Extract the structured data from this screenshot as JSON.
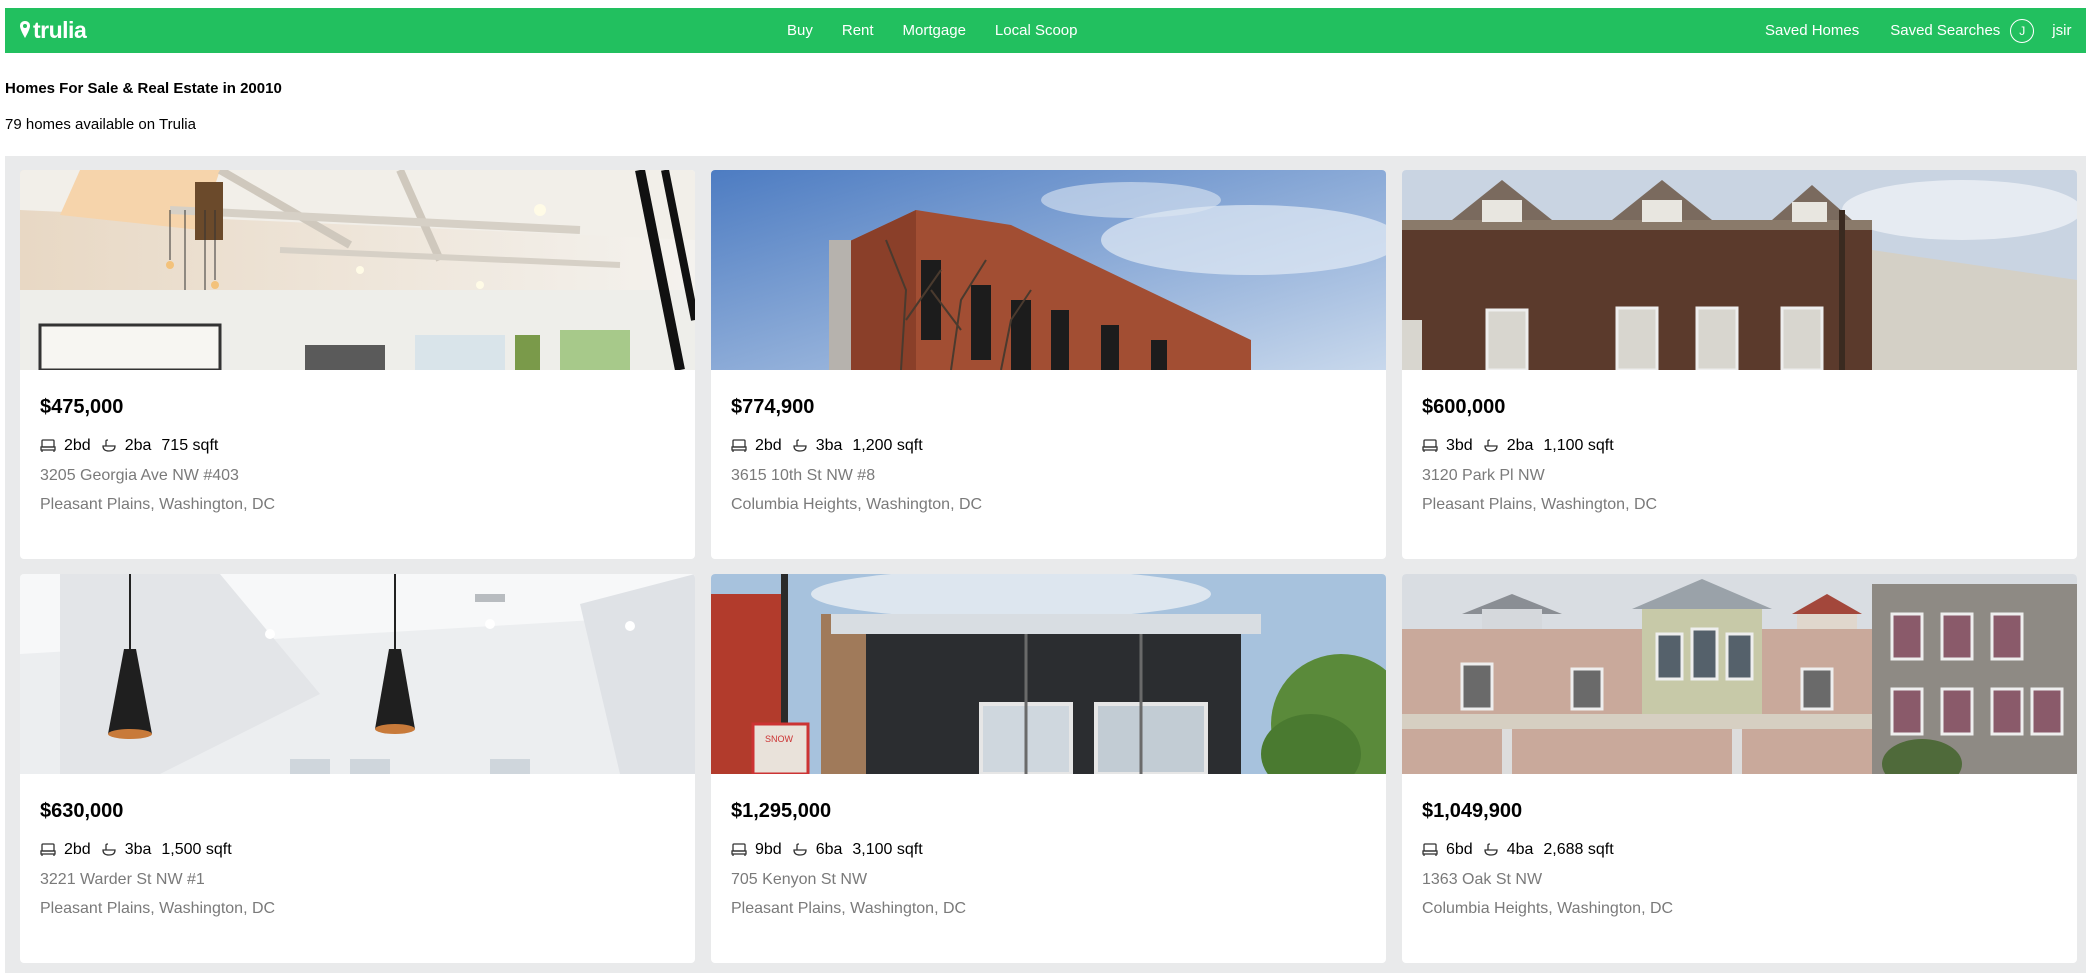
{
  "header": {
    "logo_text": "trulia",
    "nav": [
      "Buy",
      "Rent",
      "Mortgage",
      "Local Scoop"
    ],
    "saved_homes": "Saved Homes",
    "saved_searches": "Saved Searches",
    "avatar_initial": "J",
    "username": "jsir"
  },
  "page": {
    "title": "Homes For Sale & Real Estate in 20010",
    "count_text": "79 homes available on Trulia"
  },
  "listings": [
    {
      "price": "$475,000",
      "beds": "2bd",
      "baths": "2ba",
      "sqft": "715 sqft",
      "address": "3205 Georgia Ave NW #403",
      "area": "Pleasant Plains, Washington, DC"
    },
    {
      "price": "$774,900",
      "beds": "2bd",
      "baths": "3ba",
      "sqft": "1,200 sqft",
      "address": "3615 10th St NW #8",
      "area": "Columbia Heights, Washington, DC"
    },
    {
      "price": "$600,000",
      "beds": "3bd",
      "baths": "2ba",
      "sqft": "1,100 sqft",
      "address": "3120 Park Pl NW",
      "area": "Pleasant Plains, Washington, DC"
    },
    {
      "price": "$630,000",
      "beds": "2bd",
      "baths": "3ba",
      "sqft": "1,500 sqft",
      "address": "3221 Warder St NW #1",
      "area": "Pleasant Plains, Washington, DC"
    },
    {
      "price": "$1,295,000",
      "beds": "9bd",
      "baths": "6ba",
      "sqft": "3,100 sqft",
      "address": "705 Kenyon St NW",
      "area": "Pleasant Plains, Washington, DC"
    },
    {
      "price": "$1,049,900",
      "beds": "6bd",
      "baths": "4ba",
      "sqft": "2,688 sqft",
      "address": "1363 Oak St NW",
      "area": "Columbia Heights, Washington, DC"
    }
  ],
  "icons": {
    "logo": "map-pin-icon",
    "beds": "bed-icon",
    "baths": "bathtub-icon"
  },
  "colors": {
    "brand": "#22c05f",
    "muted_text": "#7a7a7a",
    "results_bg": "#e9eaeb"
  }
}
